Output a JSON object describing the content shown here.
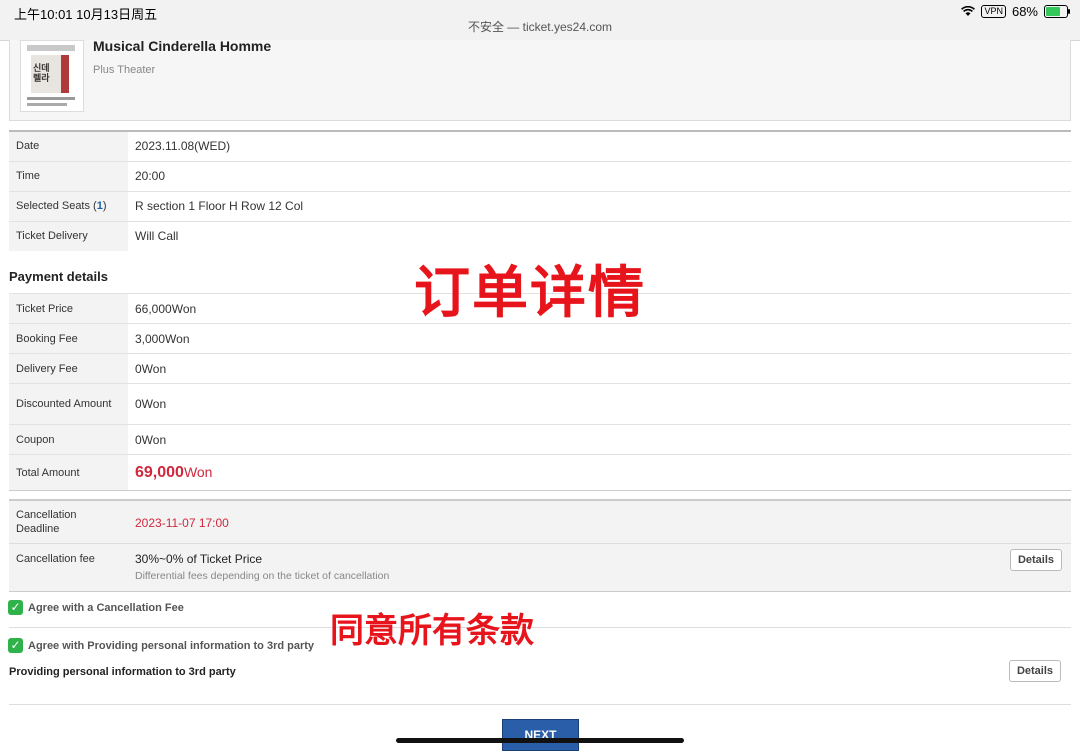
{
  "status_bar": {
    "time": "上午10:01  10月13日周五",
    "url": "不安全 — ticket.yes24.com",
    "vpn": "VPN",
    "battery": "68%"
  },
  "show": {
    "title": "Musical Cinderella Homme",
    "venue": "Plus Theater",
    "poster_text": "신데 렐라"
  },
  "booking_info": [
    {
      "label": "Date",
      "value": "2023.11.08(WED)"
    },
    {
      "label": "Time",
      "value": "20:00"
    },
    {
      "label": "Selected Seats (",
      "count": "1",
      "label_end": ")",
      "value": "R section 1 Floor H Row 12 Col"
    },
    {
      "label": "Ticket Delivery",
      "value": "Will Call"
    }
  ],
  "payment": {
    "heading": "Payment details",
    "rows": [
      {
        "label": "Ticket Price",
        "value": "66,000Won"
      },
      {
        "label": "Booking Fee",
        "value": "3,000Won"
      },
      {
        "label": "Delivery Fee",
        "value": "0Won"
      },
      {
        "label": "Discounted Amount",
        "value": "0Won"
      },
      {
        "label": "Coupon",
        "value": "0Won"
      }
    ],
    "total_label": "Total Amount",
    "total_value": "69,000",
    "total_unit": "Won"
  },
  "cancellation": {
    "deadline_label": "Cancellation Deadline",
    "deadline_value": "2023-11-07 17:00",
    "fee_label": "Cancellation fee",
    "fee_value": "30%~0% of Ticket Price",
    "fee_note": "Differential fees depending on the ticket of cancellation",
    "details_label": "Details"
  },
  "agreements": {
    "cancel_fee": "Agree with a Cancellation Fee",
    "third_party": "Agree with Providing personal information to 3rd party",
    "third_party_title": "Providing personal information to 3rd party",
    "details_label": "Details"
  },
  "overlays": {
    "order_details": "订单详情",
    "agree_all": "同意所有条款"
  },
  "next_button": "NEXT",
  "colors": {
    "accent_red": "#d0273c",
    "button_blue": "#2a5ea8",
    "check_green": "#2fb24a",
    "overlay_red": "#e8141c"
  }
}
